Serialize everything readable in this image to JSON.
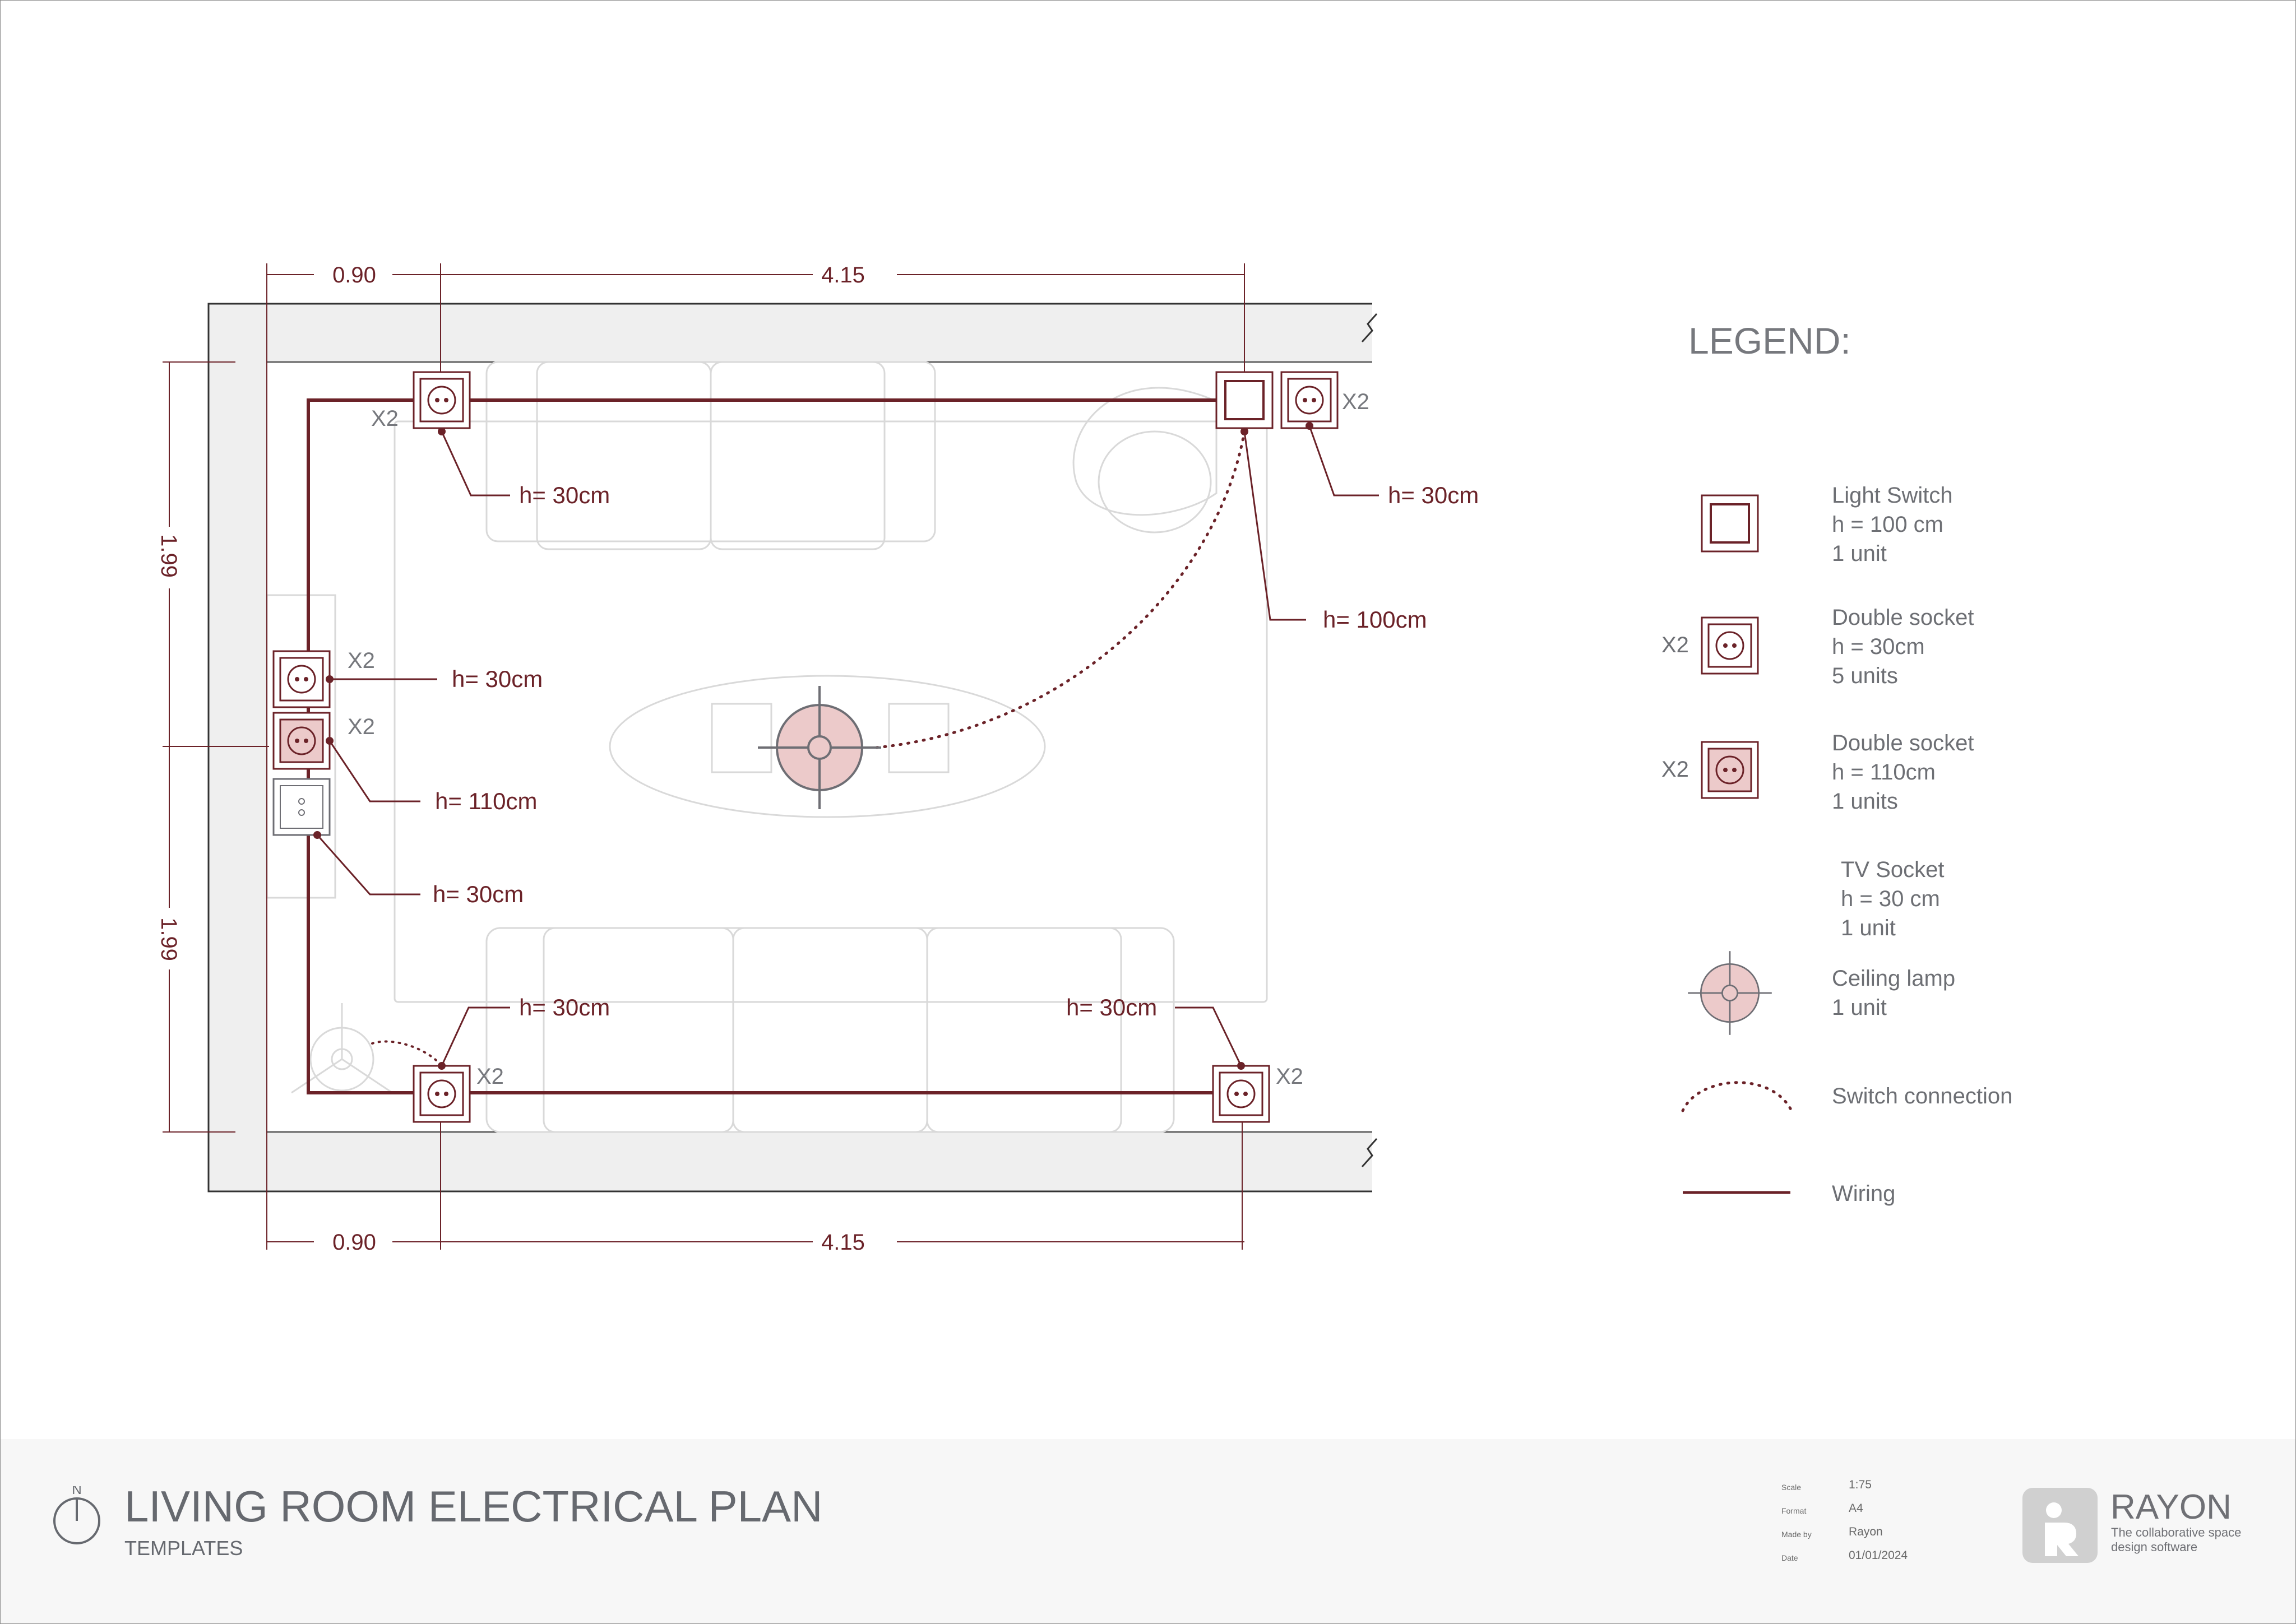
{
  "drawing": {
    "title": "LIVING ROOM ELECTRICAL PLAN",
    "subtitle": "TEMPLATES",
    "north_label": "N",
    "colors": {
      "wiring": "#6b2228",
      "accent_fill": "#eccaca",
      "wall_fill": "#efefef",
      "furniture_stroke": "#d6d6d6",
      "label": "#6b2228",
      "legend_text": "#6d6f74",
      "footer_bg": "#f7f7f7"
    }
  },
  "dimensions": {
    "top_left": "0.90",
    "top_right": "4.15",
    "bottom_left": "0.90",
    "bottom_right": "4.15",
    "left_upper": "1.99",
    "left_lower": "1.99"
  },
  "plan_labels": {
    "top_left_socket_height": "h= 30cm",
    "top_left_socket_count": "X2",
    "top_right_socket_height": "h= 30cm",
    "top_right_socket_count": "X2",
    "switch_height": "h= 100cm",
    "left_socket_1_height": "h= 30cm",
    "left_socket_1_count": "X2",
    "left_socket_2_height": "h= 110cm",
    "left_socket_2_count": "X2",
    "tv_socket_height": "h= 30cm",
    "bottom_left_socket_height": "h= 30cm",
    "bottom_left_socket_count": "X2",
    "bottom_right_socket_height": "h= 30cm",
    "bottom_right_socket_count": "X2"
  },
  "legend": {
    "title": "LEGEND:",
    "items": [
      {
        "symbol": "light-switch",
        "prefix": "",
        "lines": "Light Switch\nh = 100 cm\n1 unit"
      },
      {
        "symbol": "double-socket",
        "prefix": "X2",
        "lines": "Double socket\nh = 30cm\n5 units"
      },
      {
        "symbol": "double-socket-filled",
        "prefix": "X2",
        "lines": "Double socket\nh = 110cm\n1 units"
      },
      {
        "symbol": "tv-socket",
        "prefix": "",
        "lines": "TV Socket\nh = 30 cm\n1 unit"
      },
      {
        "symbol": "ceiling-lamp",
        "prefix": "",
        "lines": "Ceiling lamp\n1 unit"
      },
      {
        "symbol": "switch-connection",
        "prefix": "",
        "lines": "Switch connection"
      },
      {
        "symbol": "wiring",
        "prefix": "",
        "lines": "Wiring"
      }
    ]
  },
  "meta": {
    "scale_label": "Scale",
    "scale_value": "1:75",
    "format_label": "Format",
    "format_value": "A4",
    "made_by_label": "Made by",
    "made_by_value": "Rayon",
    "date_label": "Date",
    "date_value": "01/01/2024"
  },
  "brand": {
    "name": "RAYON",
    "tagline": "The collaborative space design software"
  }
}
